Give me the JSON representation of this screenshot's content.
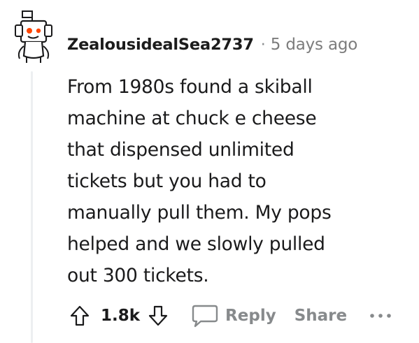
{
  "comment": {
    "author": "ZealousidealSea2737",
    "separator": "·",
    "timestamp": "5 days ago",
    "body_lines": [
      "From 1980s found a skiball",
      "machine at chuck e cheese",
      "that dispensed unlimited",
      "tickets but you had to",
      "manually pull them. My pops",
      "helped and we slowly pulled",
      "out 300 tickets."
    ],
    "score": "1.8k",
    "actions": {
      "reply_label": "Reply",
      "share_label": "Share"
    },
    "icons": {
      "avatar": "snoo-avatar-icon",
      "upvote": "upvote-arrow-icon",
      "downvote": "downvote-arrow-icon",
      "reply": "speech-bubble-icon",
      "more": "more-options-icon"
    },
    "colors": {
      "text": "#1a1a1b",
      "muted": "#878a8c",
      "avatar_accent": "#ff4500"
    }
  }
}
